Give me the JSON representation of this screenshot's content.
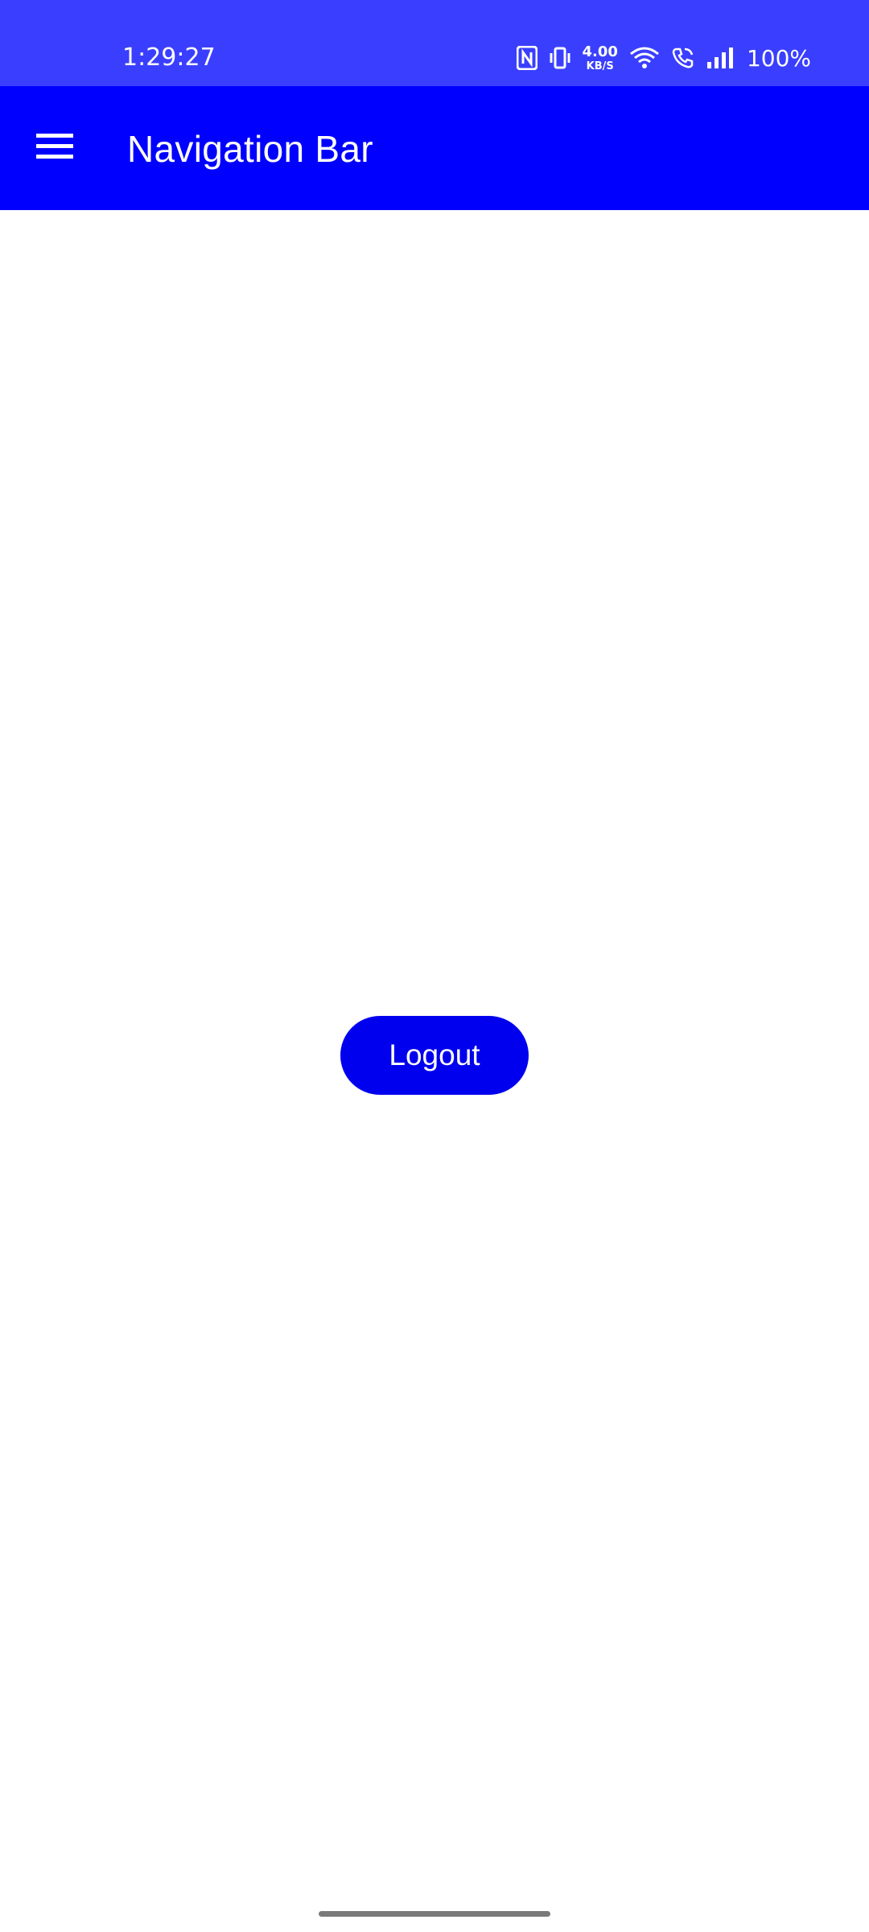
{
  "status_bar": {
    "time": "1:29:27",
    "net_speed_value": "4.00",
    "net_speed_unit": "KB/S",
    "battery": "100%",
    "icons": [
      "nfc-icon",
      "vibrate-icon",
      "wifi-icon",
      "wifi-calling-icon",
      "signal-icon"
    ],
    "background": "#3a3fff"
  },
  "app_bar": {
    "title": "Navigation Bar",
    "menu_icon": "hamburger-menu-icon",
    "background": "#0000ff"
  },
  "main": {
    "logout_label": "Logout",
    "button_color": "#0000ee"
  }
}
